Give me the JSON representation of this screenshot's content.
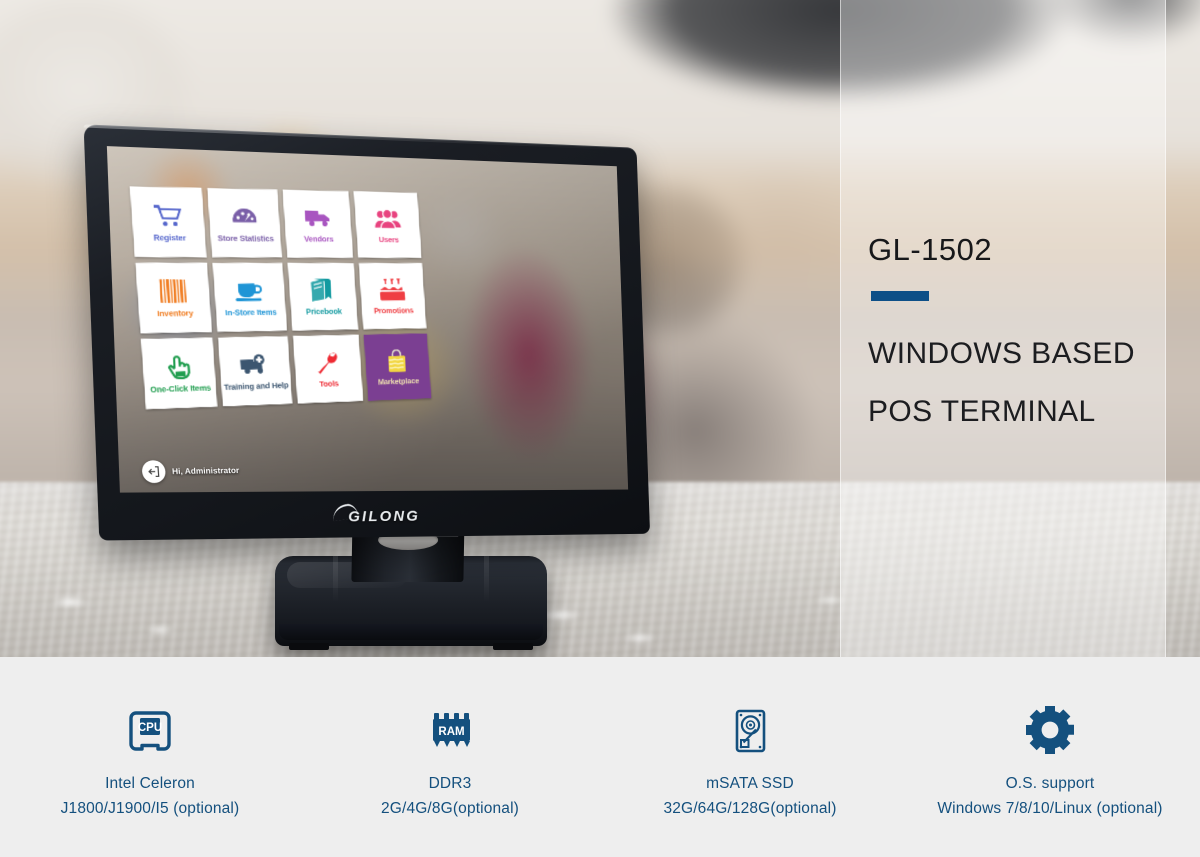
{
  "hero": {
    "model_code": "GL-1502",
    "headline_line1": "WINDOWS BASED",
    "headline_line2": "POS TERMINAL",
    "accent_color": "#0d4f87"
  },
  "device": {
    "brand": "GILONG",
    "screen": {
      "taskbar_greeting": "Hi, Administrator",
      "tiles": [
        {
          "label": "Register",
          "icon": "shopping-cart-icon",
          "color": "#5566cc"
        },
        {
          "label": "Store Statistics",
          "icon": "gauge-icon",
          "color": "#7a5fa8"
        },
        {
          "label": "Vendors",
          "icon": "delivery-truck-icon",
          "color": "#a855c0"
        },
        {
          "label": "Users",
          "icon": "people-icon",
          "color": "#e8437f"
        },
        {
          "label": "Inventory",
          "icon": "barcode-icon",
          "color": "#f07d22"
        },
        {
          "label": "In-Store Items",
          "icon": "coffee-cup-icon",
          "color": "#1f95d6"
        },
        {
          "label": "Pricebook",
          "icon": "book-icon",
          "color": "#129aa0"
        },
        {
          "label": "Promotions",
          "icon": "birthday-cake-icon",
          "color": "#ef3e43"
        },
        {
          "label": "One-Click Items",
          "icon": "pointing-hand-icon",
          "color": "#1f9d4e"
        },
        {
          "label": "Training and Help",
          "icon": "ambulance-icon",
          "color": "#3c5670"
        },
        {
          "label": "Tools",
          "icon": "wrench-icon",
          "color": "#ee2a33"
        },
        {
          "label": "Marketplace",
          "icon": "shopping-bag-icon",
          "color": "#f0e2b0",
          "highlight": true
        }
      ]
    }
  },
  "specs": {
    "accent_color": "#14507e",
    "items": [
      {
        "icon": "cpu-icon",
        "title": "Intel Celeron",
        "detail": "J1800/J1900/I5 (optional)"
      },
      {
        "icon": "ram-icon",
        "title": "DDR3",
        "detail": "2G/4G/8G(optional)"
      },
      {
        "icon": "hard-disk-icon",
        "title": "mSATA SSD",
        "detail": "32G/64G/128G(optional)"
      },
      {
        "icon": "gear-icon",
        "title": "O.S. support",
        "detail": "Windows 7/8/10/Linux (optional)"
      }
    ]
  }
}
